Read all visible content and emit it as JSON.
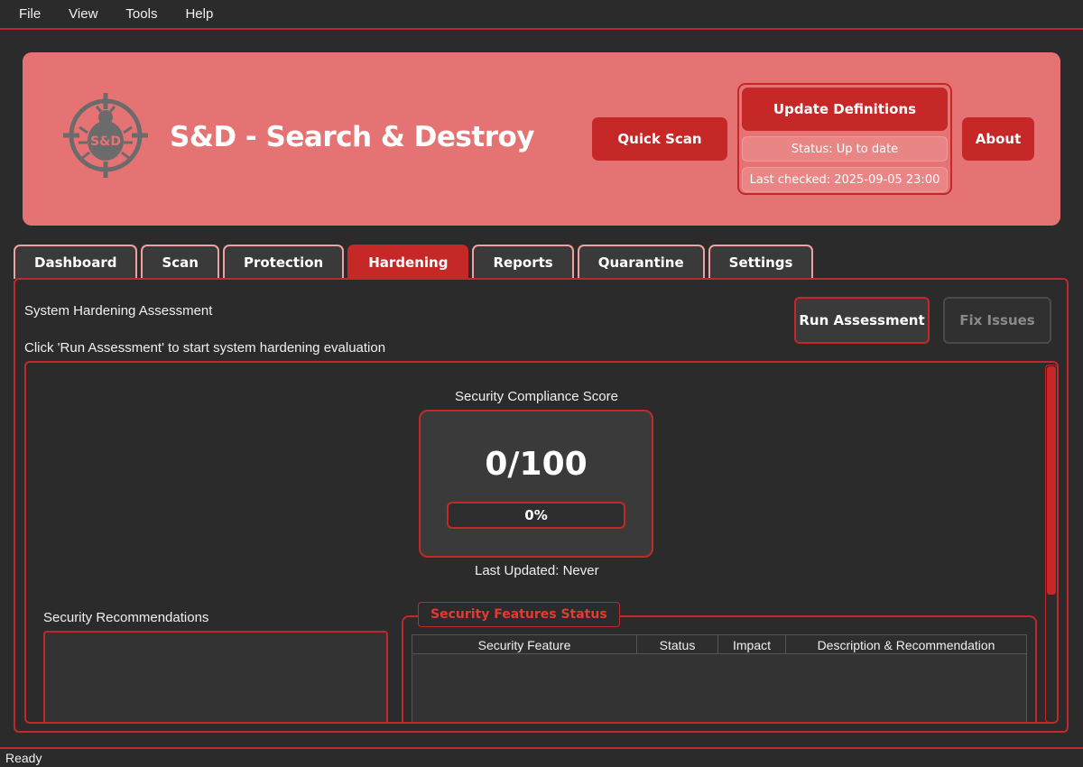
{
  "menu": [
    "File",
    "View",
    "Tools",
    "Help"
  ],
  "header": {
    "app_title": "S&D - Search & Destroy",
    "logo_icon": "bug-crosshair-icon",
    "quick_scan": "Quick Scan",
    "update_definitions": "Update Definitions",
    "status": "Status: Up to date",
    "last_checked": "Last checked: 2025-09-05 23:00",
    "about": "About"
  },
  "tabs": [
    {
      "label": "Dashboard",
      "active": false
    },
    {
      "label": "Scan",
      "active": false
    },
    {
      "label": "Protection",
      "active": false
    },
    {
      "label": "Hardening",
      "active": true
    },
    {
      "label": "Reports",
      "active": false
    },
    {
      "label": "Quarantine",
      "active": false
    },
    {
      "label": "Settings",
      "active": false
    }
  ],
  "hardening": {
    "title": "System Hardening Assessment",
    "hint": "Click 'Run Assessment' to start system hardening evaluation",
    "run_button": "Run Assessment",
    "fix_button": "Fix Issues",
    "score_label": "Security Compliance Score",
    "score_value": "0/100",
    "progress_percent": 0,
    "progress_text": "0%",
    "last_updated": "Last Updated: Never",
    "recommendations_label": "Security Recommendations",
    "features_title": "Security Features Status",
    "table_columns": [
      "Security Feature",
      "Status",
      "Impact",
      "Description & Recommendation"
    ]
  },
  "status_bar": "Ready",
  "colors": {
    "accent": "#c62828",
    "banner": "#e57373",
    "background": "#2b2b2b"
  }
}
